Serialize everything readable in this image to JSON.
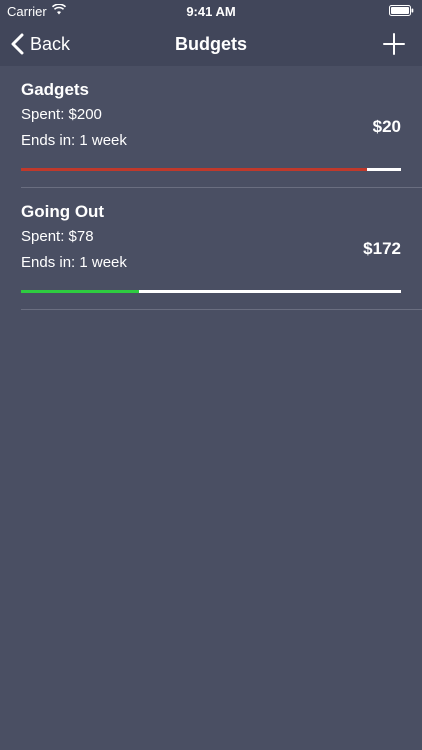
{
  "status_bar": {
    "carrier": "Carrier",
    "time": "9:41 AM"
  },
  "nav": {
    "back_label": "Back",
    "title": "Budgets"
  },
  "budgets": [
    {
      "name": "Gadgets",
      "spent": "Spent: $200",
      "ends": "Ends in: 1 week",
      "remaining": "$20",
      "progress": 0.91,
      "color": "#c0392b"
    },
    {
      "name": "Going Out",
      "spent": "Spent: $78",
      "ends": "Ends in: 1 week",
      "remaining": "$172",
      "progress": 0.31,
      "color": "#2ecc40"
    }
  ]
}
